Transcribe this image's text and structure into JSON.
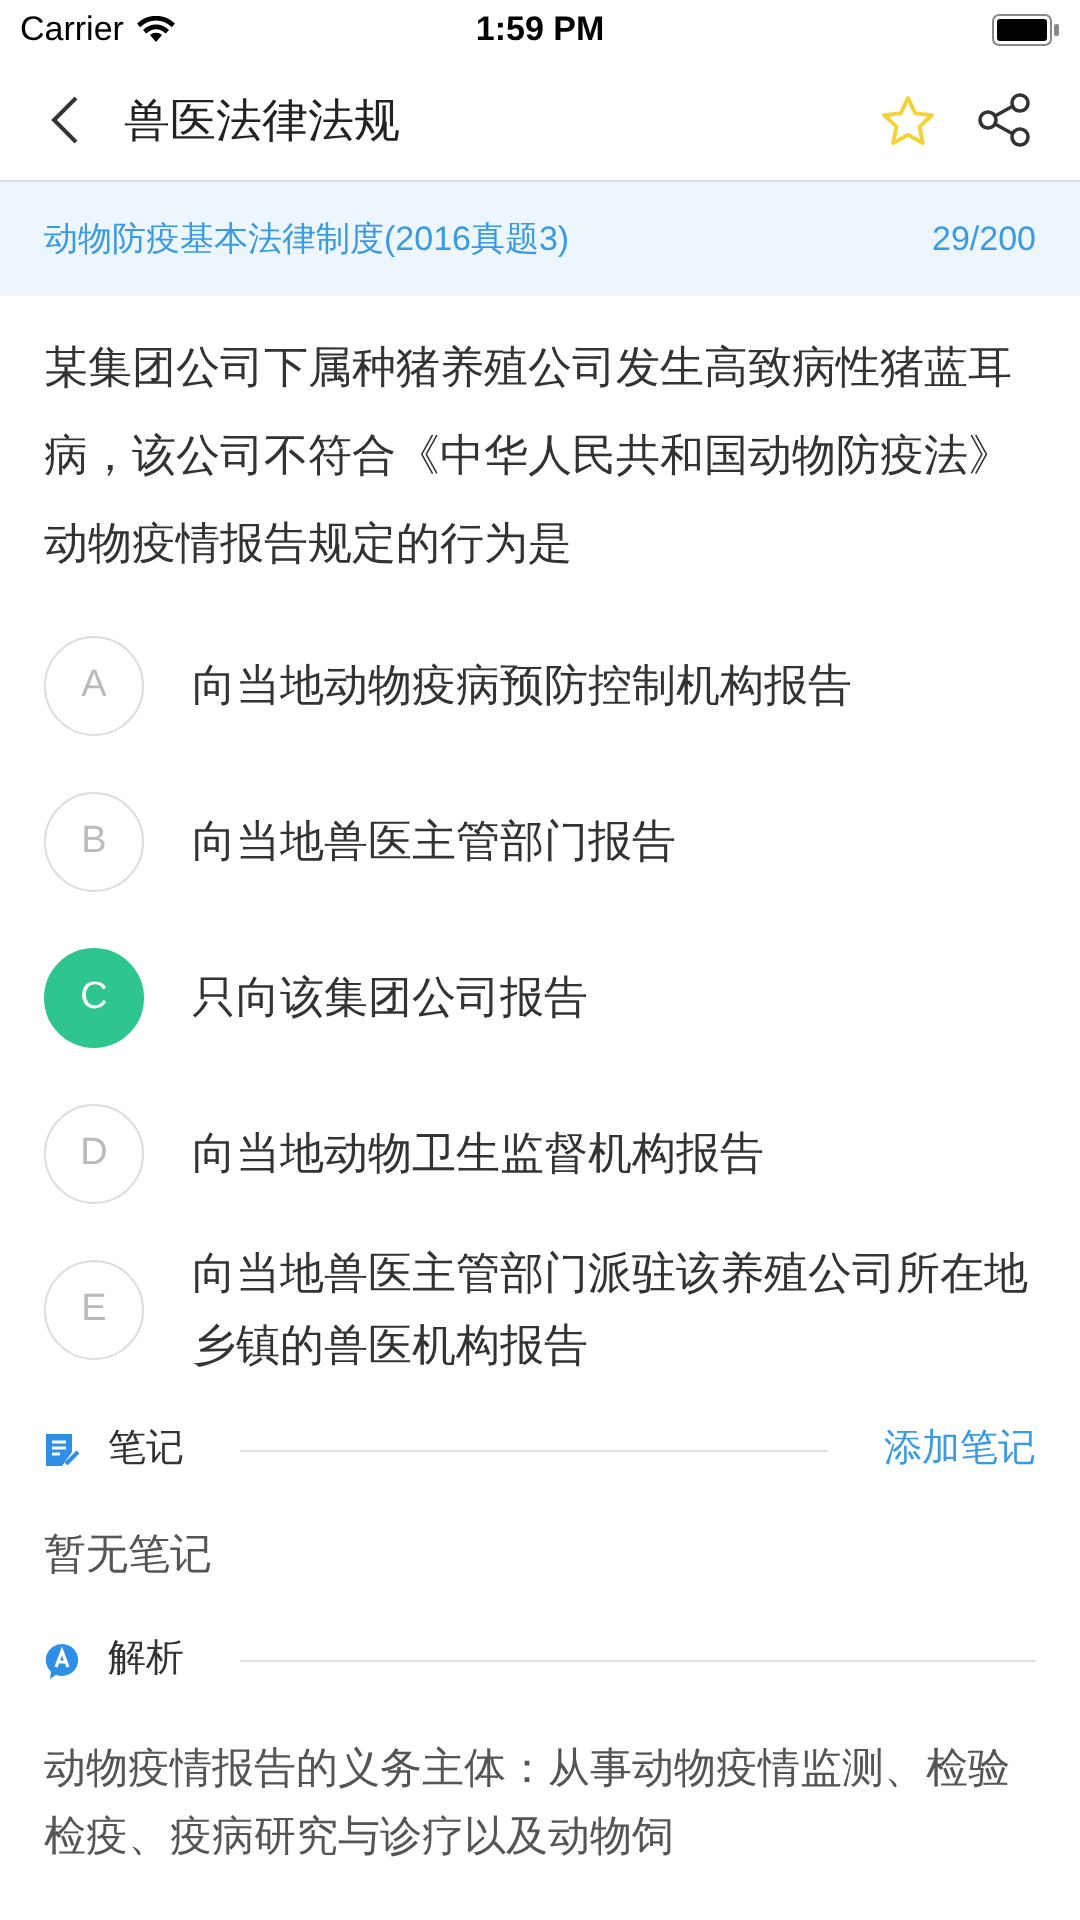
{
  "status_bar": {
    "carrier": "Carrier",
    "time": "1:59 PM"
  },
  "nav": {
    "title": "兽医法律法规",
    "favorited": false
  },
  "subheader": {
    "chapter": "动物防疫基本法律制度(2016真题3)",
    "progress": "29/200"
  },
  "question": "某集团公司下属种猪养殖公司发生高致病性猪蓝耳病，该公司不符合《中华人民共和国动物防疫法》动物疫情报告规定的行为是",
  "options": [
    {
      "letter": "A",
      "text": "向当地动物疫病预防控制机构报告",
      "selected": false
    },
    {
      "letter": "B",
      "text": "向当地兽医主管部门报告",
      "selected": false
    },
    {
      "letter": "C",
      "text": "只向该集团公司报告",
      "selected": true
    },
    {
      "letter": "D",
      "text": "向当地动物卫生监督机构报告",
      "selected": false
    },
    {
      "letter": "E",
      "text": "向当地兽医主管部门派驻该养殖公司所在地乡镇的兽医机构报告",
      "selected": false
    }
  ],
  "notes": {
    "title": "笔记",
    "action": "添加笔记",
    "empty": "暂无笔记"
  },
  "analysis": {
    "title": "解析",
    "text": "动物疫情报告的义务主体：从事动物疫情监测、检验检疫、疫病研究与诊疗以及动物饲"
  }
}
